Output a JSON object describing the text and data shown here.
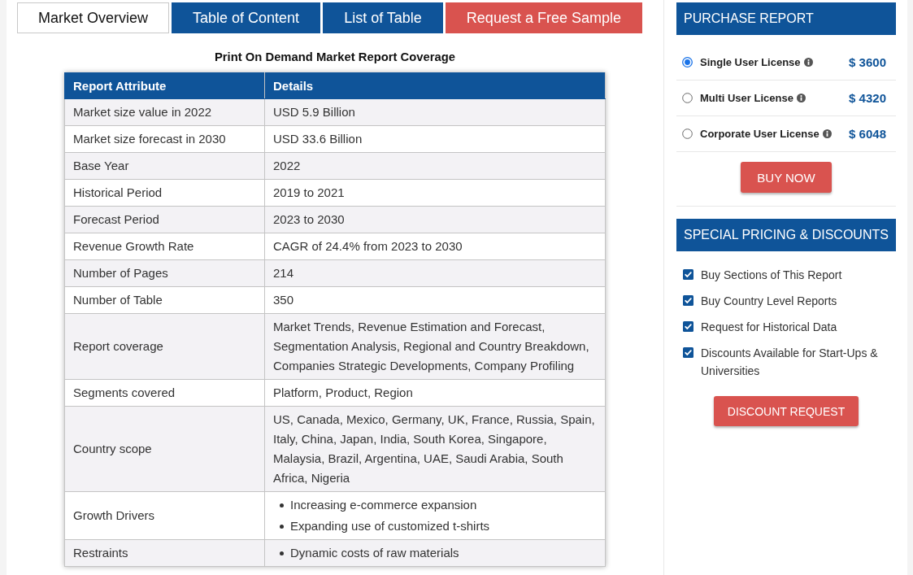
{
  "tabs": [
    {
      "label": "Market Overview",
      "kind": "tab",
      "selected": true
    },
    {
      "label": "Table of Content",
      "kind": "tab",
      "selected": false
    },
    {
      "label": "List of Table",
      "kind": "tab",
      "selected": false
    },
    {
      "label": "Request a Free Sample",
      "kind": "action",
      "selected": false
    }
  ],
  "report": {
    "title": "Print On Demand Market Report Coverage",
    "columns": [
      "Report Attribute",
      "Details"
    ],
    "rows": [
      {
        "kind": "text",
        "attribute": "Market size value in 2022",
        "details": "USD 5.9 Billion"
      },
      {
        "kind": "text",
        "attribute": "Market size forecast in 2030",
        "details": "USD 33.6 Billion"
      },
      {
        "kind": "text",
        "attribute": "Base Year",
        "details": "2022"
      },
      {
        "kind": "text",
        "attribute": "Historical Period",
        "details": "2019 to 2021"
      },
      {
        "kind": "text",
        "attribute": "Forecast Period",
        "details": "2023 to 2030"
      },
      {
        "kind": "text",
        "attribute": "Revenue Growth Rate",
        "details": "CAGR of 24.4% from 2023 to 2030"
      },
      {
        "kind": "text",
        "attribute": "Number of Pages",
        "details": "214"
      },
      {
        "kind": "text",
        "attribute": "Number of Table",
        "details": "350"
      },
      {
        "kind": "text",
        "attribute": "Report coverage",
        "details": "Market Trends, Revenue Estimation and Forecast, Segmentation Analysis, Regional and Country Breakdown, Companies Strategic Developments, Company Profiling"
      },
      {
        "kind": "text",
        "attribute": "Segments covered",
        "details": "Platform, Product, Region"
      },
      {
        "kind": "text",
        "attribute": "Country scope",
        "details": "US, Canada, Mexico, Germany, UK, France, Russia, Spain, Italy, China, Japan, India, South Korea, Singapore, Malaysia, Brazil, Argentina, UAE, Saudi Arabia, South Africa, Nigeria"
      },
      {
        "kind": "list",
        "attribute": "Growth Drivers",
        "details": [
          "Increasing e-commerce expansion",
          "Expanding use of customized t-shirts"
        ]
      },
      {
        "kind": "list",
        "attribute": "Restraints",
        "details": [
          "Dynamic costs of raw materials"
        ]
      }
    ]
  },
  "purchase": {
    "title": "PURCHASE REPORT",
    "licenses": [
      {
        "name": "Single User License",
        "price": "$ 3600",
        "selected": true
      },
      {
        "name": "Multi User License",
        "price": "$ 4320",
        "selected": false
      },
      {
        "name": "Corporate User License",
        "price": "$ 6048",
        "selected": false
      }
    ],
    "button": "BUY NOW"
  },
  "discounts": {
    "title": "SPECIAL PRICING & DISCOUNTS",
    "items": [
      {
        "label": "Buy Sections of This Report",
        "checked": true
      },
      {
        "label": "Buy Country Level Reports",
        "checked": true
      },
      {
        "label": "Request for Historical Data",
        "checked": true
      },
      {
        "label": "Discounts Available for Start-Ups & Universities",
        "checked": true
      }
    ],
    "button": "DISCOUNT REQUEST"
  }
}
